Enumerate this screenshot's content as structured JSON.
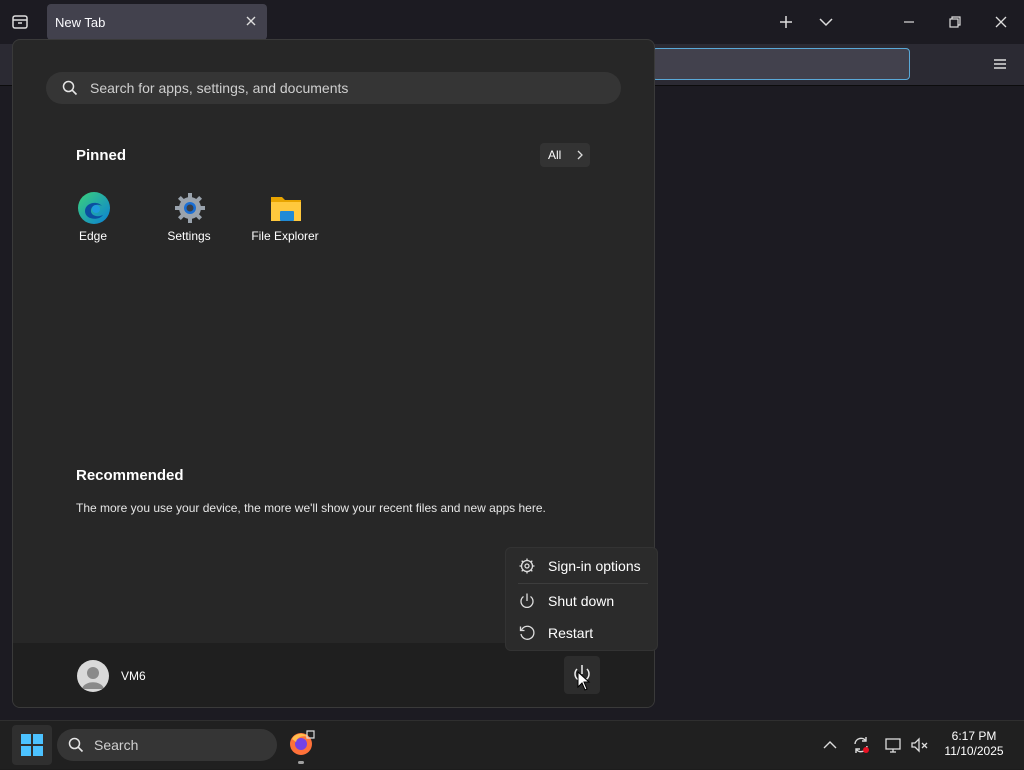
{
  "browser": {
    "tab_title": "New Tab"
  },
  "start_menu": {
    "search_placeholder": "Search for apps, settings, and documents",
    "pinned_title": "Pinned",
    "all_label": "All",
    "pinned_apps": [
      {
        "label": "Edge",
        "icon": "edge-icon"
      },
      {
        "label": "Settings",
        "icon": "gear-icon"
      },
      {
        "label": "File Explorer",
        "icon": "folder-icon"
      }
    ],
    "recommended_title": "Recommended",
    "recommended_text": "The more you use your device, the more we'll show your recent files and new apps here.",
    "user_name": "VM6"
  },
  "power_menu": {
    "items": [
      {
        "label": "Sign-in options",
        "icon": "gear-icon"
      },
      {
        "label": "Shut down",
        "icon": "power-icon"
      },
      {
        "label": "Restart",
        "icon": "restart-icon"
      }
    ]
  },
  "taskbar": {
    "search_label": "Search",
    "time": "6:17 PM",
    "date": "11/10/2025"
  },
  "colors": {
    "accent": "#5aa9d8",
    "start_bg": "#272727",
    "taskbar_bg": "#202020"
  }
}
